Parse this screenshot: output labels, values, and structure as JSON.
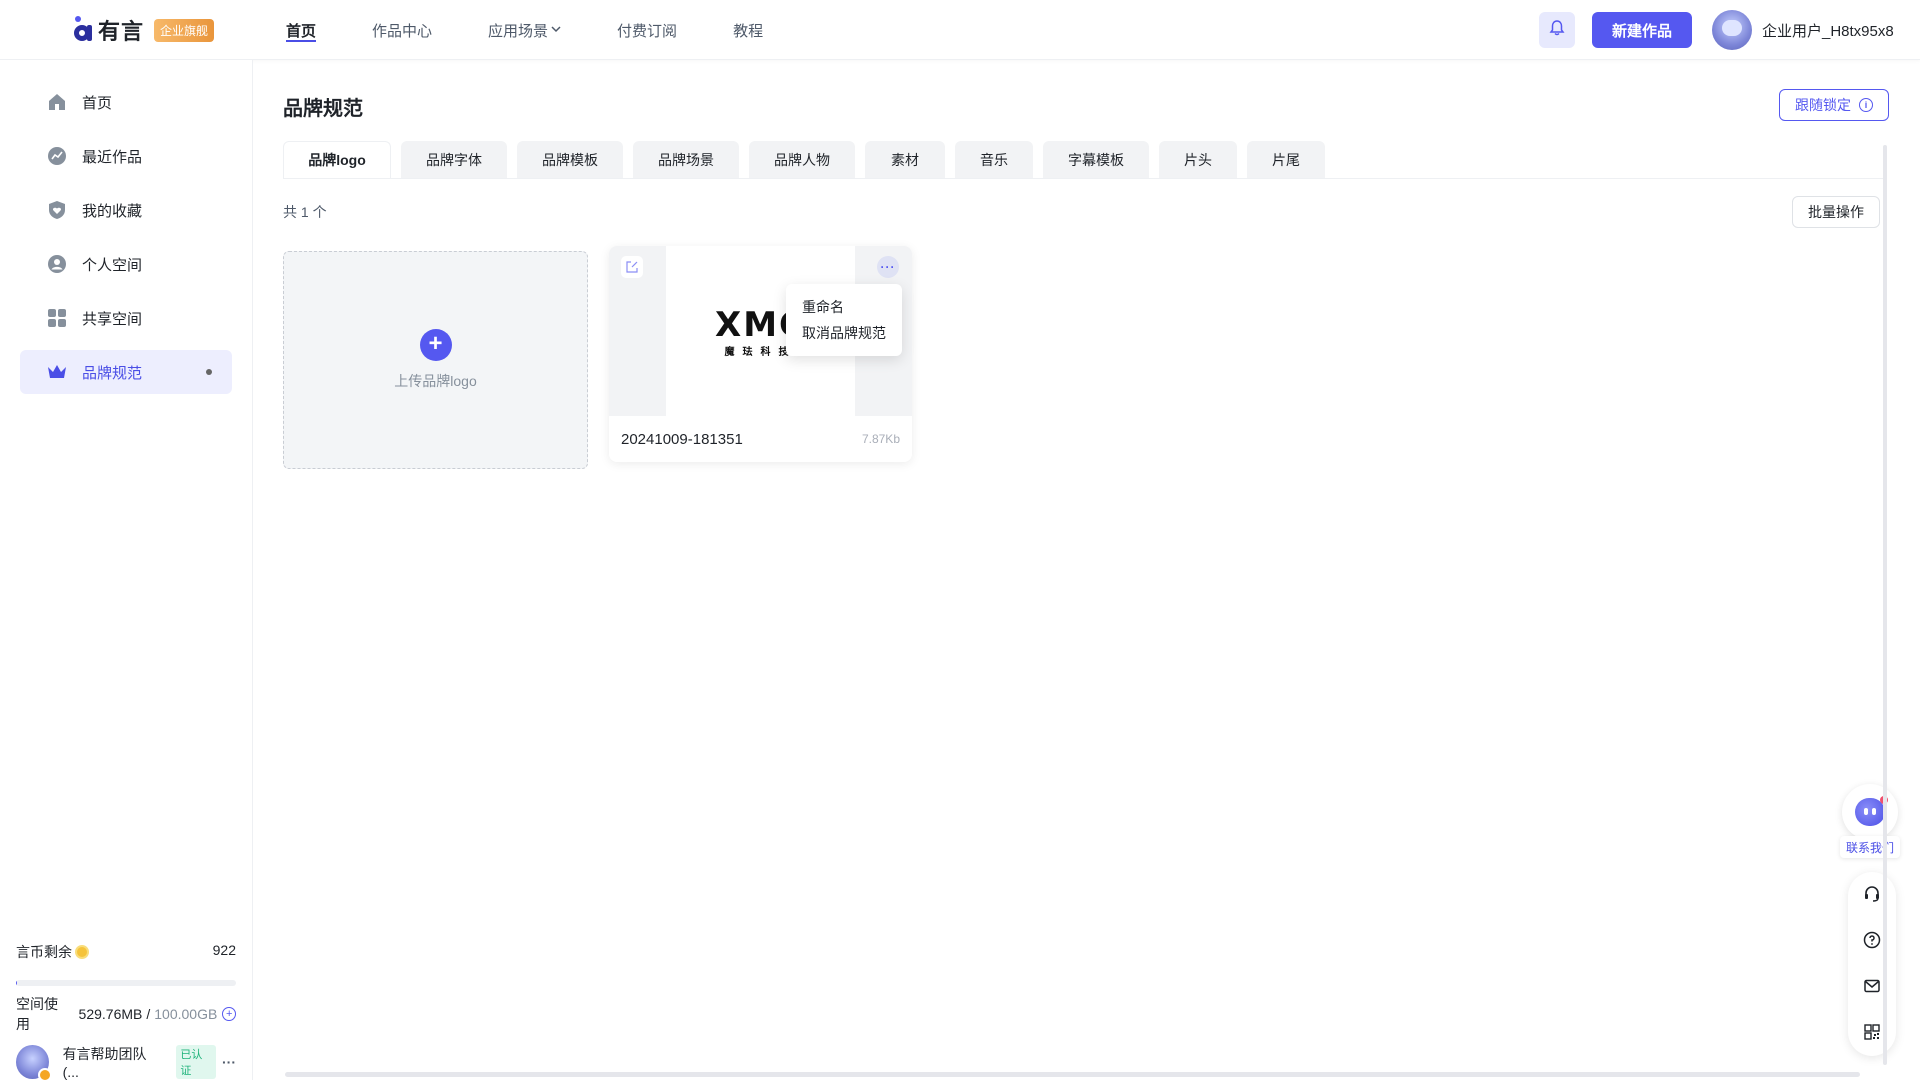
{
  "header": {
    "logo_text": "有言",
    "logo_badge": "企业旗舰",
    "nav": [
      {
        "label": "首页",
        "active": true
      },
      {
        "label": "作品中心"
      },
      {
        "label": "应用场景",
        "dropdown": true
      },
      {
        "label": "付费订阅"
      },
      {
        "label": "教程"
      }
    ],
    "bell_icon": "bell-icon",
    "new_button": "新建作品",
    "user_name": "企业用户_H8tx95x8"
  },
  "sidebar": {
    "items": [
      {
        "label": "首页",
        "icon": "home-icon"
      },
      {
        "label": "最近作品",
        "icon": "trend-icon"
      },
      {
        "label": "我的收藏",
        "icon": "favorite-icon"
      },
      {
        "label": "个人空间",
        "icon": "person-icon"
      },
      {
        "label": "共享空间",
        "icon": "grid-icon"
      },
      {
        "label": "品牌规范",
        "icon": "crown-icon",
        "active": true
      }
    ],
    "coins_label": "言币剩余",
    "coins_value": "922",
    "storage_label": "空间使用",
    "storage_used": "529.76MB",
    "storage_sep": "/",
    "storage_total": "100.00GB",
    "storage_fraction": 0.005,
    "team_name": "有言帮助团队 (...",
    "team_badge": "已认证",
    "team_more": "···"
  },
  "main": {
    "title": "品牌规范",
    "follow_button": "跟随锁定",
    "tabs": [
      {
        "label": "品牌logo",
        "active": true
      },
      {
        "label": "品牌字体"
      },
      {
        "label": "品牌模板"
      },
      {
        "label": "品牌场景"
      },
      {
        "label": "品牌人物"
      },
      {
        "label": "素材"
      },
      {
        "label": "音乐"
      },
      {
        "label": "字幕模板"
      },
      {
        "label": "片头"
      },
      {
        "label": "片尾"
      }
    ],
    "count_text": "共 1 个",
    "batch_button": "批量操作",
    "upload_label": "上传品牌logo",
    "card": {
      "brand_word": "XMC",
      "brand_sub": "魔珐科技",
      "file_name": "20241009-181351",
      "file_size": "7.87Kb",
      "more": "···"
    },
    "menu": [
      "重命名",
      "取消品牌规范"
    ]
  },
  "float": {
    "contact_label": "联系我们",
    "tools": [
      "headset-icon",
      "help-icon",
      "mail-icon",
      "qrcode-icon"
    ]
  },
  "colors": {
    "accent": "#5558f0",
    "badge": "#e9953b"
  }
}
